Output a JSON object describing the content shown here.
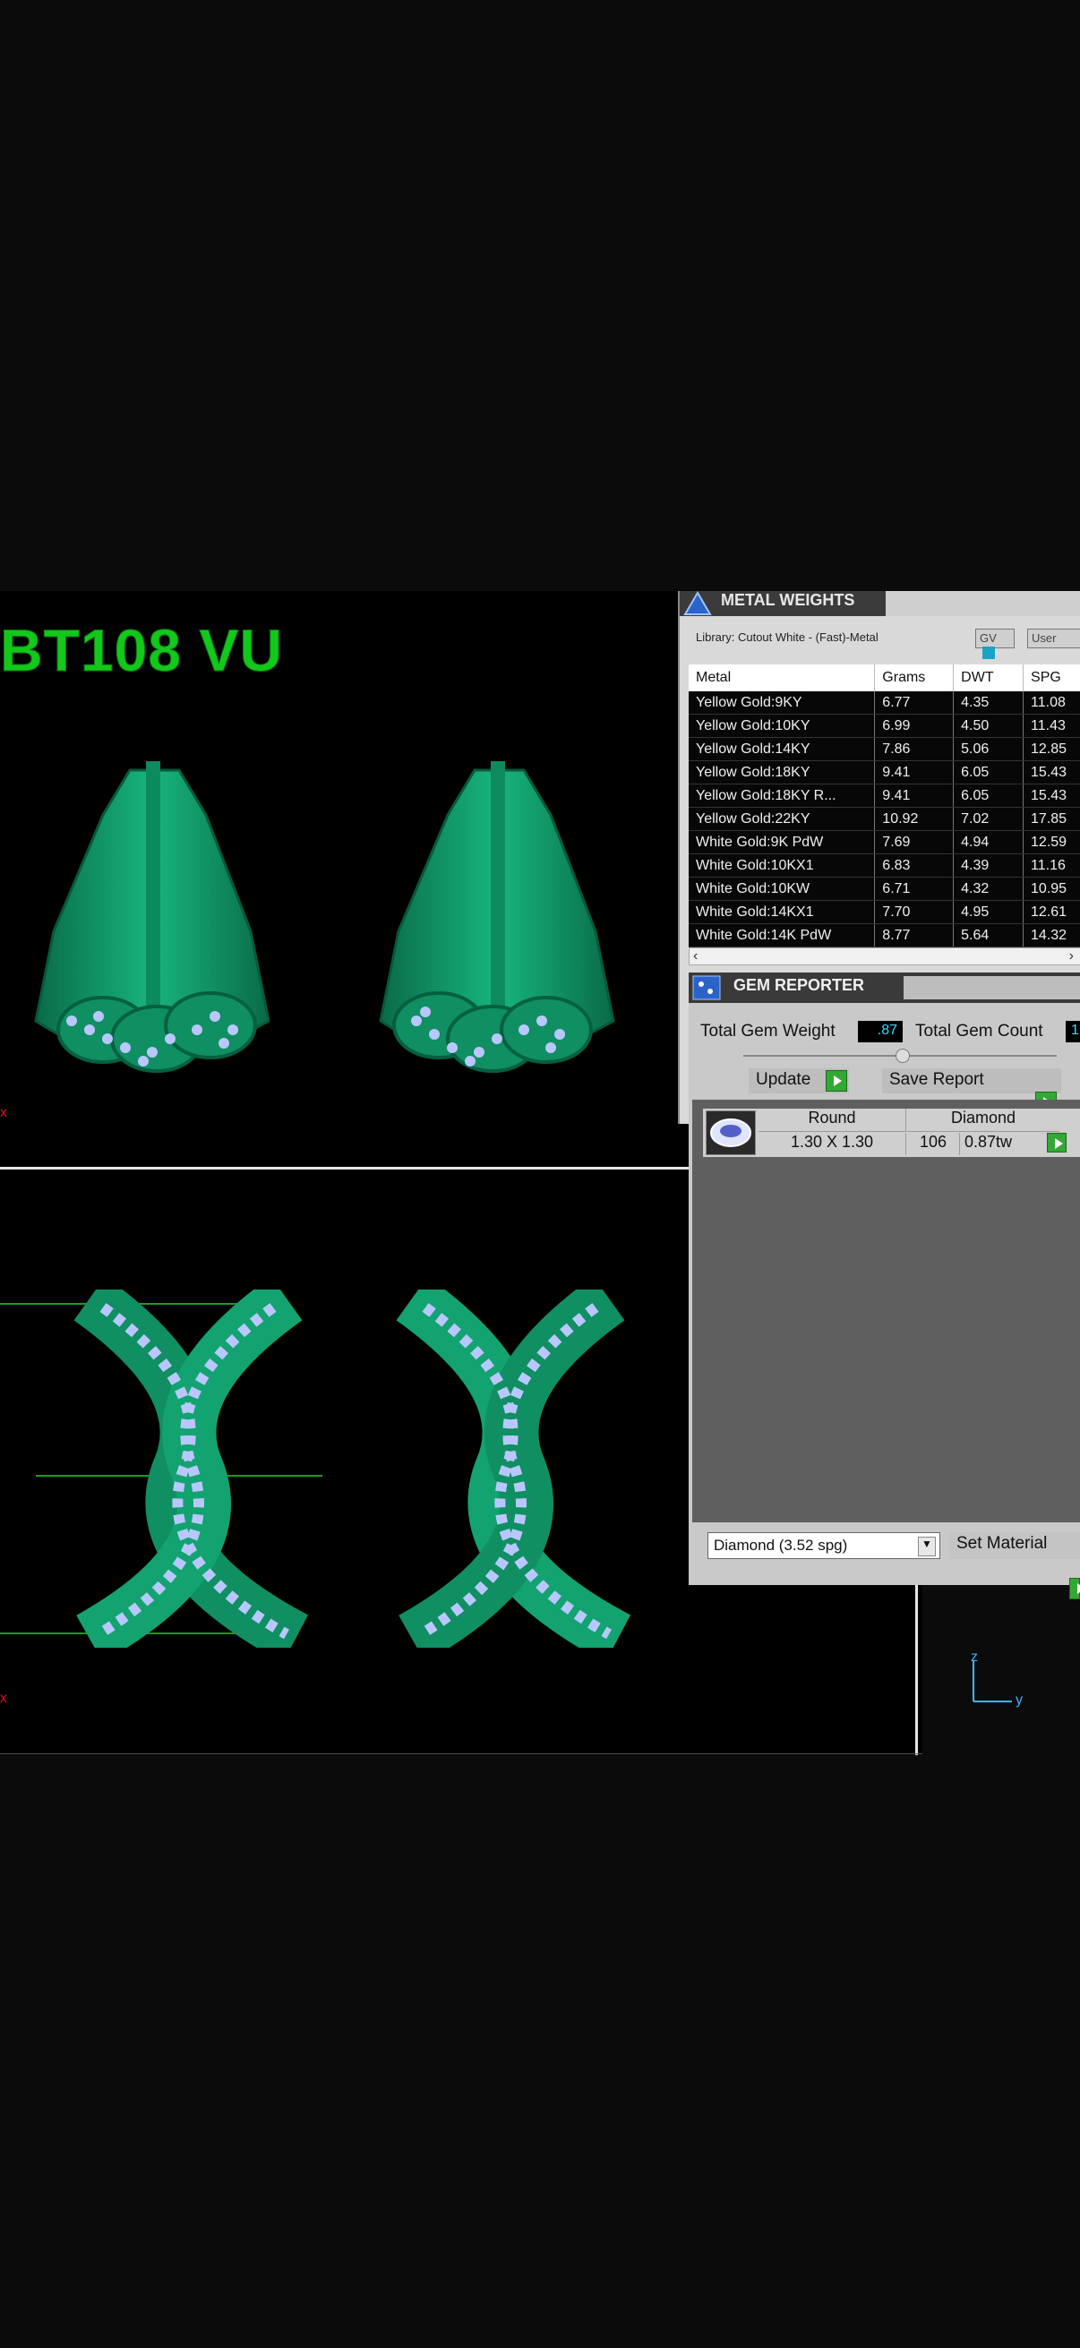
{
  "viewport": {
    "part_title": "BT108 VU",
    "axis_z": "z",
    "axis_y": "y",
    "axis_x_marks": [
      "x",
      "x"
    ]
  },
  "metal_weights": {
    "title": "METAL WEIGHTS",
    "library": "Library: Cutout White - (Fast)-Metal",
    "gv_label": "GV",
    "user_label": "User",
    "columns": [
      "Metal",
      "Grams",
      "DWT",
      "SPG"
    ],
    "rows": [
      [
        "Yellow Gold:9KY",
        "6.77",
        "4.35",
        "11.08"
      ],
      [
        "Yellow Gold:10KY",
        "6.99",
        "4.50",
        "11.43"
      ],
      [
        "Yellow Gold:14KY",
        "7.86",
        "5.06",
        "12.85"
      ],
      [
        "Yellow Gold:18KY",
        "9.41",
        "6.05",
        "15.43"
      ],
      [
        "Yellow Gold:18KY R...",
        "9.41",
        "6.05",
        "15.43"
      ],
      [
        "Yellow Gold:22KY",
        "10.92",
        "7.02",
        "17.85"
      ],
      [
        "White Gold:9K PdW",
        "7.69",
        "4.94",
        "12.59"
      ],
      [
        "White Gold:10KX1",
        "6.83",
        "4.39",
        "11.16"
      ],
      [
        "White Gold:10KW",
        "6.71",
        "4.32",
        "10.95"
      ],
      [
        "White Gold:14KX1",
        "7.70",
        "4.95",
        "12.61"
      ],
      [
        "White Gold:14K PdW",
        "8.77",
        "5.64",
        "14.32"
      ]
    ]
  },
  "gem_reporter": {
    "title": "GEM REPORTER",
    "total_gem_weight_label": "Total Gem Weight",
    "total_gem_weight_value": ".87",
    "total_gem_count_label": "Total Gem Count",
    "total_gem_count_value": "1",
    "update_label": "Update",
    "save_report_label": "Save Report",
    "gem_row": {
      "shape": "Round",
      "size": "1.30 X 1.30",
      "material": "Diamond",
      "count": "106",
      "weight": "0.87tw"
    },
    "material_select": "Diamond   (3.52 spg)",
    "set_material_label": "Set Material"
  },
  "colors": {
    "model_green": "#0f8f62",
    "gem_blue": "#b9c7ff",
    "title_green": "#12c81a"
  }
}
